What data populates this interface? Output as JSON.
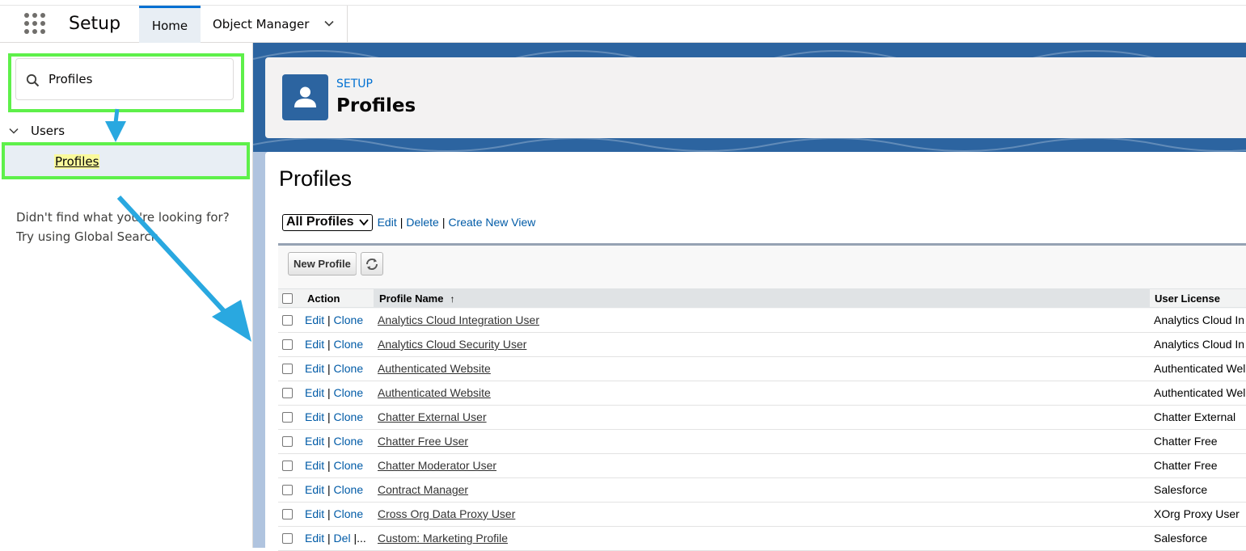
{
  "topnav": {
    "app_name": "Setup",
    "tabs": [
      {
        "label": "Home"
      },
      {
        "label": "Object Manager"
      }
    ]
  },
  "sidebar": {
    "search_value": "Profiles",
    "tree_section": "Users",
    "tree_item": "Profiles",
    "not_found_line1": "Didn't find what you're looking for?",
    "not_found_line2": "Try using Global Search."
  },
  "header": {
    "breadcrumb": "SETUP",
    "title": "Profiles"
  },
  "content": {
    "heading": "Profiles",
    "view_selected": "All Profiles",
    "view_links": {
      "edit": "Edit",
      "delete": "Delete",
      "create": "Create New View"
    },
    "buttons": {
      "new_profile": "New Profile"
    },
    "columns": {
      "action": "Action",
      "profile_name": "Profile Name",
      "sort_indicator": "↑",
      "user_license": "User License"
    },
    "action_sep": "|",
    "rows": [
      {
        "a1": "Edit",
        "a2": "Clone",
        "a3": "",
        "name": "Analytics Cloud Integration User",
        "license": "Analytics Cloud In"
      },
      {
        "a1": "Edit",
        "a2": "Clone",
        "a3": "",
        "name": "Analytics Cloud Security User",
        "license": "Analytics Cloud In"
      },
      {
        "a1": "Edit",
        "a2": "Clone",
        "a3": "",
        "name": "Authenticated Website",
        "license": "Authenticated Wel"
      },
      {
        "a1": "Edit",
        "a2": "Clone",
        "a3": "",
        "name": "Authenticated Website",
        "license": "Authenticated Wel"
      },
      {
        "a1": "Edit",
        "a2": "Clone",
        "a3": "",
        "name": "Chatter External User",
        "license": "Chatter External"
      },
      {
        "a1": "Edit",
        "a2": "Clone",
        "a3": "",
        "name": "Chatter Free User",
        "license": "Chatter Free"
      },
      {
        "a1": "Edit",
        "a2": "Clone",
        "a3": "",
        "name": "Chatter Moderator User",
        "license": "Chatter Free"
      },
      {
        "a1": "Edit",
        "a2": "Clone",
        "a3": "",
        "name": "Contract Manager",
        "license": "Salesforce"
      },
      {
        "a1": "Edit",
        "a2": "Clone",
        "a3": "",
        "name": "Cross Org Data Proxy User",
        "license": "XOrg Proxy User"
      },
      {
        "a1": "Edit",
        "a2": "Del",
        "a3": "|...",
        "name": "Custom: Marketing Profile",
        "license": "Salesforce"
      }
    ]
  },
  "colors": {
    "highlight_border": "#5ef04a",
    "annotation_arrow": "#29a8e0",
    "brand_blue": "#2c64a0",
    "link_blue": "#015ba7"
  }
}
